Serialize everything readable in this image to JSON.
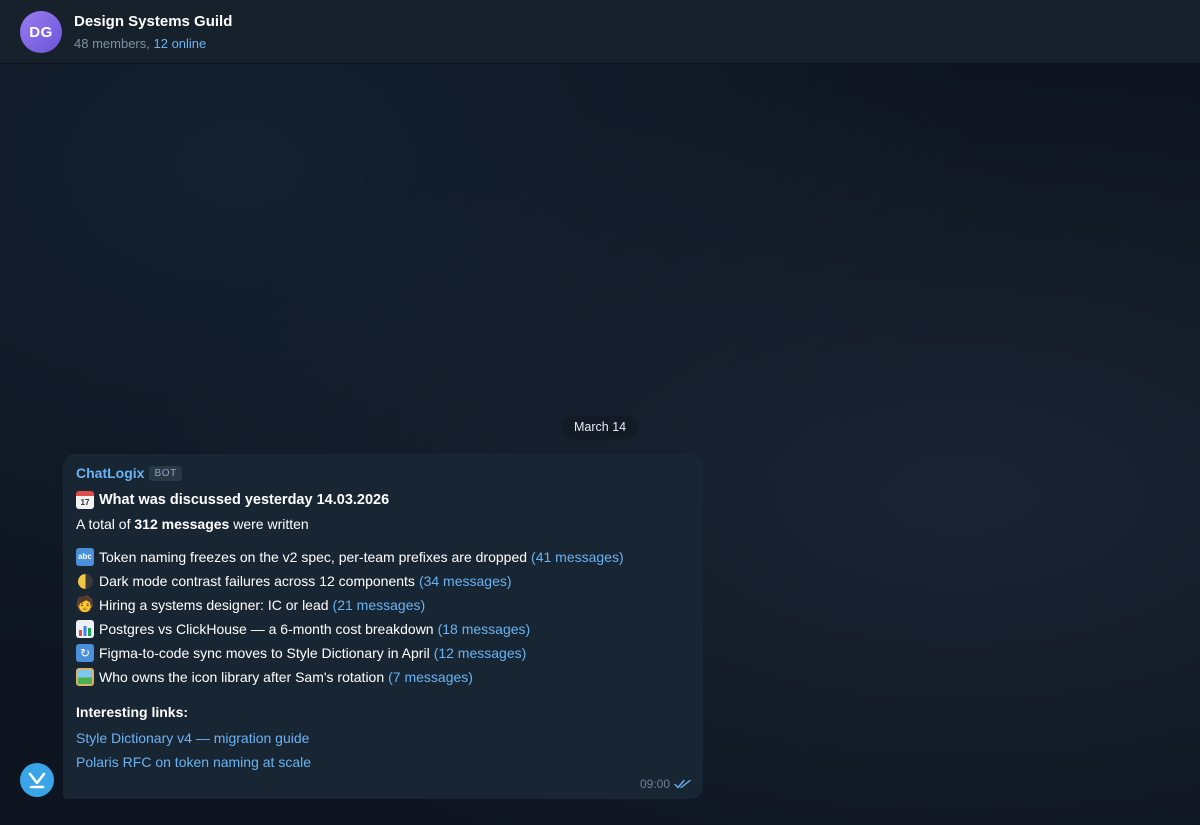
{
  "header": {
    "avatar_initials": "DG",
    "title": "Design Systems Guild",
    "members": "48 members,",
    "online": "12 online"
  },
  "date_separator": "March 14",
  "message": {
    "sender": "ChatLogix",
    "badge": "BOT",
    "title": "What was discussed yesterday 14.03.2026",
    "total_prefix": "A total of ",
    "total_bold": "312 messages",
    "total_suffix": " were written",
    "topics": [
      {
        "icon": "abc-icon",
        "text": "Token naming freezes on the v2 spec, per-team prefixes are dropped",
        "count": "(41 messages)"
      },
      {
        "icon": "half-moon-icon",
        "text": "Dark mode contrast failures across 12 components",
        "count": "(34 messages)"
      },
      {
        "icon": "technologist-icon",
        "text": "Hiring a systems designer: IC or lead",
        "count": "(21 messages)"
      },
      {
        "icon": "bar-chart-icon",
        "text": "Postgres vs ClickHouse — a 6-month cost breakdown",
        "count": "(18 messages)"
      },
      {
        "icon": "sync-icon",
        "text": "Figma-to-code sync moves to Style Dictionary in April",
        "count": "(12 messages)"
      },
      {
        "icon": "framed-picture-icon",
        "text": "Who owns the icon library after Sam's rotation",
        "count": "(7 messages)"
      }
    ],
    "links_title": "Interesting links:",
    "links": [
      "Style Dictionary v4 — migration guide",
      "Polaris RFC on token naming at scale"
    ],
    "time": "09:00"
  },
  "colors": {
    "accent": "#6ab3f3",
    "bubble": "#182533",
    "header": "#17212b"
  }
}
